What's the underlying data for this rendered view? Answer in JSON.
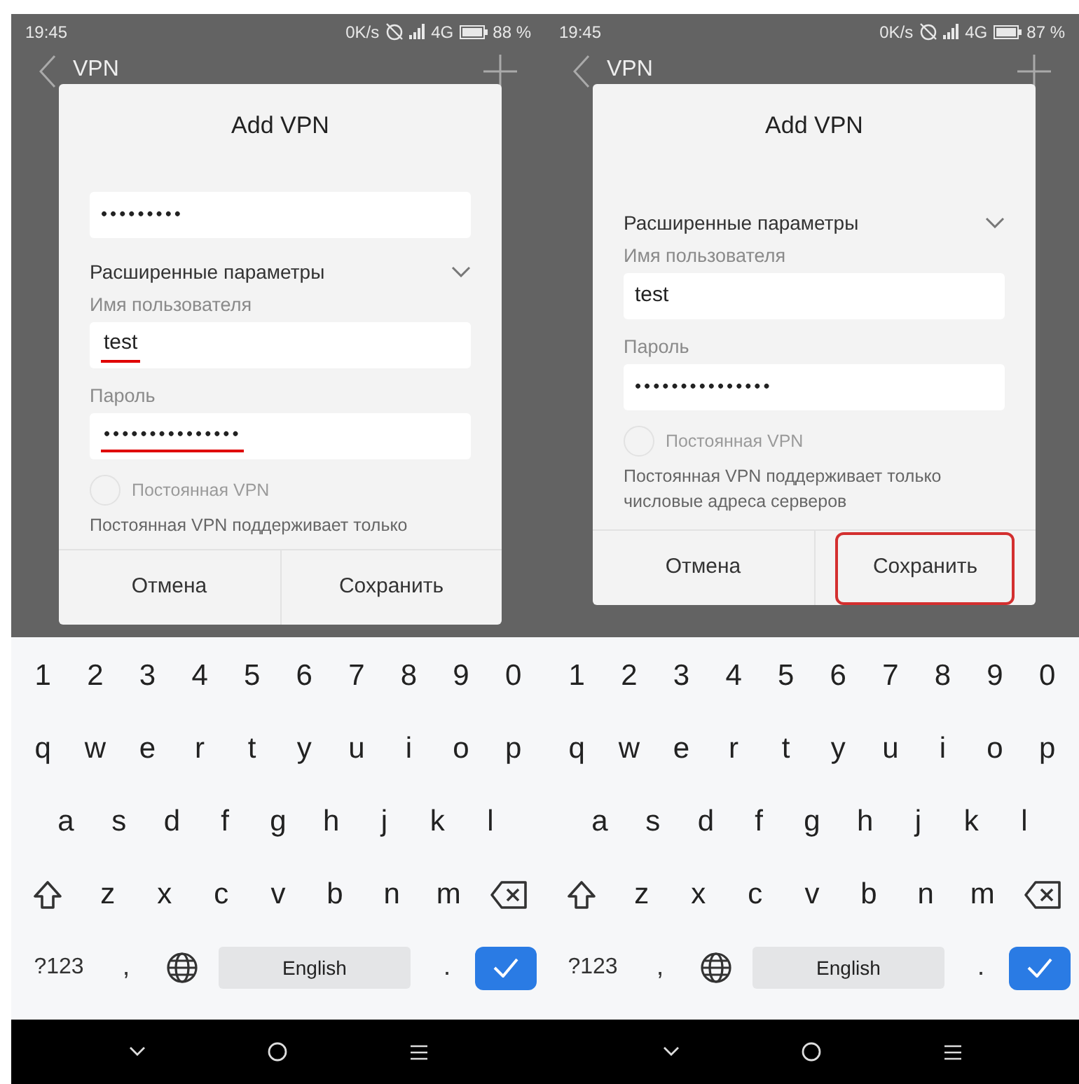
{
  "panels": [
    {
      "status_bar": {
        "time": "19:45",
        "speed": "0K/s",
        "network": "4G",
        "battery": "88 %"
      },
      "app_bar": {
        "title": "VPN"
      },
      "dialog": {
        "title": "Add VPN",
        "items": [
          {
            "kind": "password_field",
            "value": "•••••••••",
            "underlined": false
          },
          {
            "kind": "expander",
            "label": "Расширенные параметры",
            "expanded": true
          },
          {
            "kind": "label",
            "text": "Имя пользователя"
          },
          {
            "kind": "text_field",
            "value": "test",
            "underlined": true
          },
          {
            "kind": "label",
            "text": "Пароль"
          },
          {
            "kind": "password_field",
            "value": "•••••••••••••••",
            "underlined": true
          },
          {
            "kind": "radio",
            "label": "Постоянная VPN",
            "checked": false,
            "disabled": true
          },
          {
            "kind": "note",
            "text": "Постоянная VPN поддерживает только"
          }
        ],
        "buttons": [
          {
            "label": "Отмена",
            "highlighted": false
          },
          {
            "label": "Сохранить",
            "highlighted": false
          }
        ]
      },
      "keyboard": {
        "rows": [
          [
            {
              "kind": "char",
              "label": "1"
            },
            {
              "kind": "char",
              "label": "2"
            },
            {
              "kind": "char",
              "label": "3"
            },
            {
              "kind": "char",
              "label": "4"
            },
            {
              "kind": "char",
              "label": "5"
            },
            {
              "kind": "char",
              "label": "6"
            },
            {
              "kind": "char",
              "label": "7"
            },
            {
              "kind": "char",
              "label": "8"
            },
            {
              "kind": "char",
              "label": "9"
            },
            {
              "kind": "char",
              "label": "0"
            }
          ],
          [
            {
              "kind": "char",
              "label": "q"
            },
            {
              "kind": "char",
              "label": "w"
            },
            {
              "kind": "char",
              "label": "e"
            },
            {
              "kind": "char",
              "label": "r"
            },
            {
              "kind": "char",
              "label": "t"
            },
            {
              "kind": "char",
              "label": "y"
            },
            {
              "kind": "char",
              "label": "u"
            },
            {
              "kind": "char",
              "label": "i"
            },
            {
              "kind": "char",
              "label": "o"
            },
            {
              "kind": "char",
              "label": "p"
            }
          ],
          [
            {
              "kind": "char",
              "label": "a"
            },
            {
              "kind": "char",
              "label": "s"
            },
            {
              "kind": "char",
              "label": "d"
            },
            {
              "kind": "char",
              "label": "f"
            },
            {
              "kind": "char",
              "label": "g"
            },
            {
              "kind": "char",
              "label": "h"
            },
            {
              "kind": "char",
              "label": "j"
            },
            {
              "kind": "char",
              "label": "k"
            },
            {
              "kind": "char",
              "label": "l"
            }
          ],
          [
            {
              "kind": "shift"
            },
            {
              "kind": "char",
              "label": "z"
            },
            {
              "kind": "char",
              "label": "x"
            },
            {
              "kind": "char",
              "label": "c"
            },
            {
              "kind": "char",
              "label": "v"
            },
            {
              "kind": "char",
              "label": "b"
            },
            {
              "kind": "char",
              "label": "n"
            },
            {
              "kind": "char",
              "label": "m"
            },
            {
              "kind": "backspace"
            }
          ]
        ],
        "bottom_bar": [
          {
            "kind": "mode",
            "label": "?123"
          },
          {
            "kind": "punct",
            "label": ","
          },
          {
            "kind": "globe"
          },
          {
            "kind": "space",
            "label": "English"
          },
          {
            "kind": "punct",
            "label": "."
          },
          {
            "kind": "enter"
          }
        ]
      }
    },
    {
      "status_bar": {
        "time": "19:45",
        "speed": "0K/s",
        "network": "4G",
        "battery": "87 %"
      },
      "app_bar": {
        "title": "VPN"
      },
      "dialog": {
        "title": "Add VPN",
        "items": [
          {
            "kind": "expander",
            "label": "Расширенные параметры",
            "expanded": true
          },
          {
            "kind": "label",
            "text": "Имя пользователя"
          },
          {
            "kind": "text_field",
            "value": "test",
            "underlined": false
          },
          {
            "kind": "label",
            "text": "Пароль"
          },
          {
            "kind": "password_field",
            "value": "•••••••••••••••",
            "underlined": false
          },
          {
            "kind": "radio",
            "label": "Постоянная VPN",
            "checked": false,
            "disabled": true
          },
          {
            "kind": "note",
            "text": "Постоянная VPN поддерживает только числовые адреса серверов"
          }
        ],
        "buttons": [
          {
            "label": "Отмена",
            "highlighted": false
          },
          {
            "label": "Сохранить",
            "highlighted": true
          }
        ]
      },
      "keyboard": {
        "rows": [
          [
            {
              "kind": "char",
              "label": "1"
            },
            {
              "kind": "char",
              "label": "2"
            },
            {
              "kind": "char",
              "label": "3"
            },
            {
              "kind": "char",
              "label": "4"
            },
            {
              "kind": "char",
              "label": "5"
            },
            {
              "kind": "char",
              "label": "6"
            },
            {
              "kind": "char",
              "label": "7"
            },
            {
              "kind": "char",
              "label": "8"
            },
            {
              "kind": "char",
              "label": "9"
            },
            {
              "kind": "char",
              "label": "0"
            }
          ],
          [
            {
              "kind": "char",
              "label": "q"
            },
            {
              "kind": "char",
              "label": "w"
            },
            {
              "kind": "char",
              "label": "e"
            },
            {
              "kind": "char",
              "label": "r"
            },
            {
              "kind": "char",
              "label": "t"
            },
            {
              "kind": "char",
              "label": "y"
            },
            {
              "kind": "char",
              "label": "u"
            },
            {
              "kind": "char",
              "label": "i"
            },
            {
              "kind": "char",
              "label": "o"
            },
            {
              "kind": "char",
              "label": "p"
            }
          ],
          [
            {
              "kind": "char",
              "label": "a"
            },
            {
              "kind": "char",
              "label": "s"
            },
            {
              "kind": "char",
              "label": "d"
            },
            {
              "kind": "char",
              "label": "f"
            },
            {
              "kind": "char",
              "label": "g"
            },
            {
              "kind": "char",
              "label": "h"
            },
            {
              "kind": "char",
              "label": "j"
            },
            {
              "kind": "char",
              "label": "k"
            },
            {
              "kind": "char",
              "label": "l"
            }
          ],
          [
            {
              "kind": "shift"
            },
            {
              "kind": "char",
              "label": "z"
            },
            {
              "kind": "char",
              "label": "x"
            },
            {
              "kind": "char",
              "label": "c"
            },
            {
              "kind": "char",
              "label": "v"
            },
            {
              "kind": "char",
              "label": "b"
            },
            {
              "kind": "char",
              "label": "n"
            },
            {
              "kind": "char",
              "label": "m"
            },
            {
              "kind": "backspace"
            }
          ]
        ],
        "bottom_bar": [
          {
            "kind": "mode",
            "label": "?123"
          },
          {
            "kind": "punct",
            "label": ","
          },
          {
            "kind": "globe"
          },
          {
            "kind": "space",
            "label": "English"
          },
          {
            "kind": "punct",
            "label": "."
          },
          {
            "kind": "enter"
          }
        ]
      }
    }
  ]
}
